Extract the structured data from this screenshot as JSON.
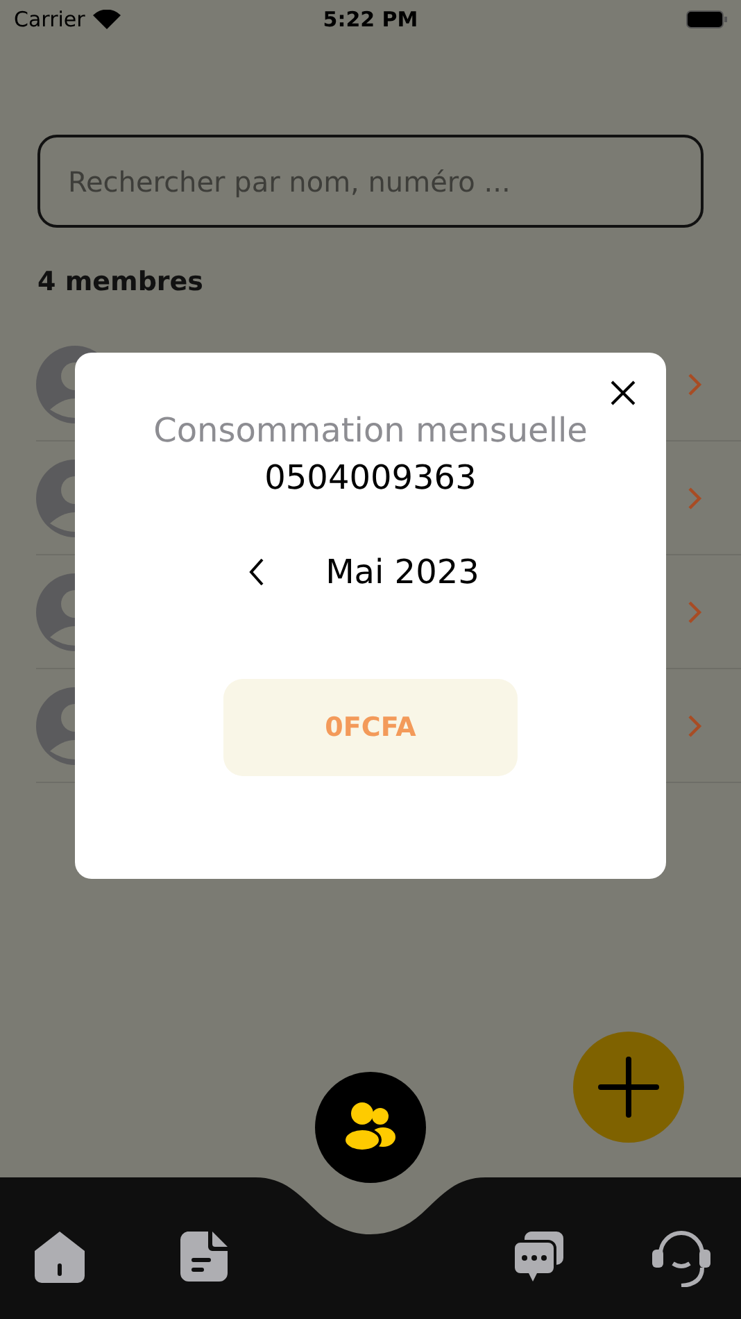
{
  "status_bar": {
    "carrier": "Carrier",
    "time": "5:22 PM"
  },
  "search": {
    "placeholder": "Rechercher par nom, numéro ..."
  },
  "member_count": "4 membres",
  "members": [
    {
      "kind": "member"
    },
    {
      "kind": "member"
    },
    {
      "kind": "member"
    },
    {
      "kind": "member"
    }
  ],
  "modal": {
    "title": "Consommation mensuelle",
    "number": "0504009363",
    "month": "Mai 2023",
    "amount": "0FCFA"
  },
  "tabs": [
    {
      "kind": "home",
      "selected": false
    },
    {
      "kind": "document",
      "selected": false
    },
    {
      "kind": "team",
      "selected": true
    },
    {
      "kind": "chat",
      "selected": false
    },
    {
      "kind": "support",
      "selected": false
    }
  ]
}
